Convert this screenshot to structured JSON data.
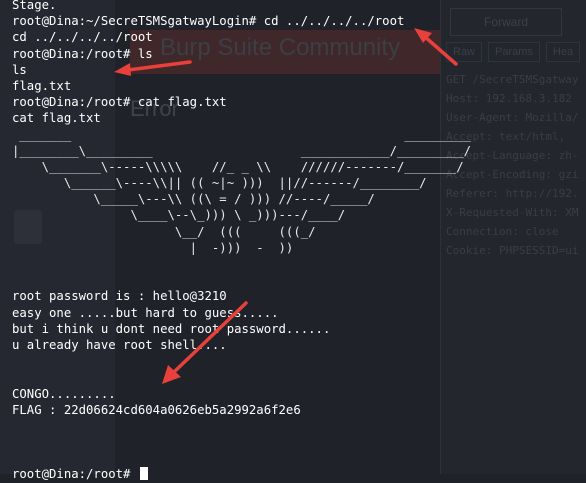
{
  "background": {
    "burp_title": "Burp Suite Community",
    "error_title": "Error",
    "forward_button": "Forward",
    "tabs": [
      "Raw",
      "Params",
      "Hea"
    ],
    "request_lines": [
      "GET /SecreTSMSgatway",
      "Host: 192.168.3.182",
      "User-Agent: Mozilla/",
      "Accept: text/html,",
      "Accept-Language: zh-",
      "Accept-Encoding: gzi",
      "Referer: http://192.",
      "X-Requested-With: XM",
      "Connection: close",
      "Cookie: PHPSESSID=ui"
    ]
  },
  "terminal": {
    "lines": [
      "Stage.",
      "root@Dina:~/SecreTSMSgatwayLogin# cd ../../../../root",
      "cd ../../../../root",
      "root@Dina:/root# ls",
      "ls",
      "flag.txt",
      "root@Dina:/root# cat flag.txt",
      "cat flag.txt"
    ],
    "ascii_art": [
      " _______                                             _________",
      "|________\\_________                    ____________/_________/",
      "    \\_______\\-----\\\\\\\\\\    //_ _ \\\\    //////-------/_______/",
      "       \\______\\----\\\\|| (( ~|~ )))  ||//------/________/",
      "           \\_____\\---\\\\ ((\\ = / ))) //----/_____/",
      "                \\____\\--\\_))) \\ _)))---/____/",
      "                      \\__/  (((     (((_/",
      "                        |  -)))  -  ))"
    ],
    "message_lines": [
      "root password is : hello@3210",
      "easy one .....but hard to guess.....",
      "but i think u dont need root password......",
      "u already have root shell....",
      "CONGO.........",
      "FLAG : 22d06624cd604a0626eb5a2992a6f2e6"
    ],
    "final_prompt": "root@Dina:/root# "
  },
  "colors": {
    "background": "#1f2228",
    "text": "#ffffff",
    "arrow": "#e8403a"
  }
}
